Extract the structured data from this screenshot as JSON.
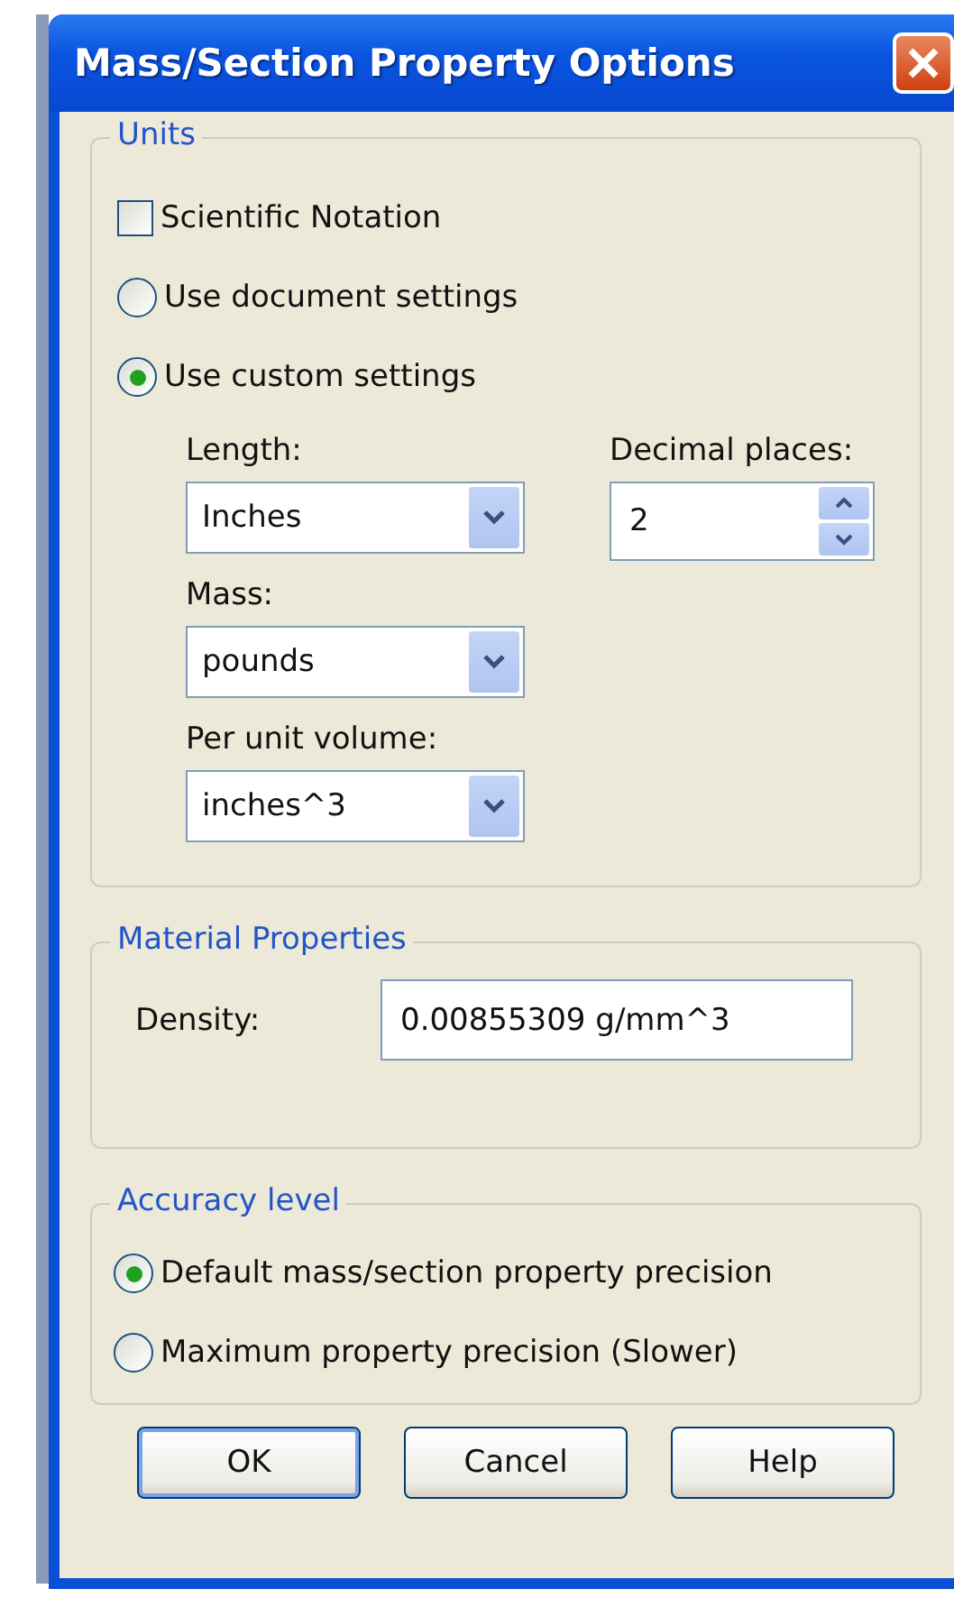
{
  "window": {
    "title": "Mass/Section Property Options"
  },
  "units": {
    "legend": "Units",
    "scientific_notation": {
      "label": "Scientific Notation",
      "checked": false
    },
    "source": [
      {
        "label": "Use document settings",
        "selected": false
      },
      {
        "label": "Use custom settings",
        "selected": true
      }
    ],
    "length": {
      "label": "Length:",
      "value": "Inches"
    },
    "decimal_places": {
      "label": "Decimal places:",
      "value": "2"
    },
    "mass": {
      "label": "Mass:",
      "value": "pounds"
    },
    "per_unit_volume": {
      "label": "Per unit volume:",
      "value": "inches^3"
    }
  },
  "material_properties": {
    "legend": "Material Properties",
    "density": {
      "label": "Density:",
      "value": "0.00855309 g/mm^3"
    }
  },
  "accuracy_level": {
    "legend": "Accuracy level",
    "options": [
      {
        "label": "Default mass/section property precision",
        "selected": true
      },
      {
        "label": "Maximum property precision (Slower)",
        "selected": false
      }
    ]
  },
  "buttons": [
    {
      "label": "OK",
      "default": true
    },
    {
      "label": "Cancel",
      "default": false
    },
    {
      "label": "Help",
      "default": false
    }
  ]
}
